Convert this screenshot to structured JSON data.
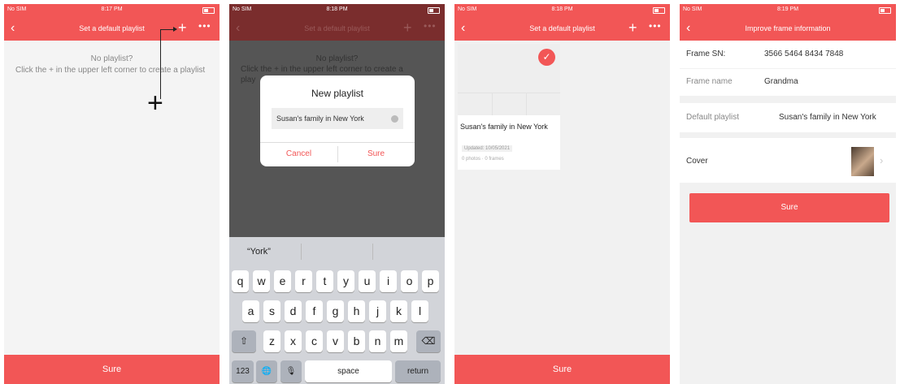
{
  "panel1": {
    "carrier": "No SIM",
    "time": "8:17 PM",
    "title": "Set a default playlist",
    "plus": "+",
    "more": "•••",
    "empty_title": "No playlist?",
    "empty_hint": "Click the + in the upper left corner to create a playlist",
    "annotation_plus": "+",
    "sure": "Sure"
  },
  "panel2": {
    "carrier": "No SIM",
    "time": "8:18 PM",
    "title": "Set a default playlist",
    "plus": "+",
    "more": "•••",
    "bg_text1": "No playlist?",
    "bg_text2": "Click the + in the upper left corner to create a",
    "bg_text3": "play",
    "dialog_title": "New playlist",
    "dialog_input": "Susan's family in New York",
    "cancel": "Cancel",
    "sure": "Sure",
    "suggestion": "“York”",
    "row1": [
      "q",
      "w",
      "e",
      "r",
      "t",
      "y",
      "u",
      "i",
      "o",
      "p"
    ],
    "row2": [
      "a",
      "s",
      "d",
      "f",
      "g",
      "h",
      "j",
      "k",
      "l"
    ],
    "row3": [
      "z",
      "x",
      "c",
      "v",
      "b",
      "n",
      "m"
    ],
    "shift": "⇧",
    "backspace": "⌫",
    "num": "123",
    "globe": "🌐",
    "mic": "🎙",
    "space": "space",
    "return": "return"
  },
  "panel3": {
    "carrier": "No SIM",
    "time": "8:18 PM",
    "title": "Set a default playlist",
    "plus": "+",
    "more": "•••",
    "card_title": "Susan's family in New York",
    "updated": "Updated: 10/05/2021",
    "counts": "0 photos · 0 frames",
    "sure": "Sure"
  },
  "panel4": {
    "carrier": "No SIM",
    "time": "8:19 PM",
    "title": "Improve frame information",
    "sn_label": "Frame SN:",
    "sn_value": "3566 5464 8434 7848",
    "name_label": "Frame name",
    "name_value": "Grandma",
    "playlist_label": "Default playlist",
    "playlist_value": "Susan's family in New York",
    "cover_label": "Cover",
    "sure": "Sure"
  }
}
